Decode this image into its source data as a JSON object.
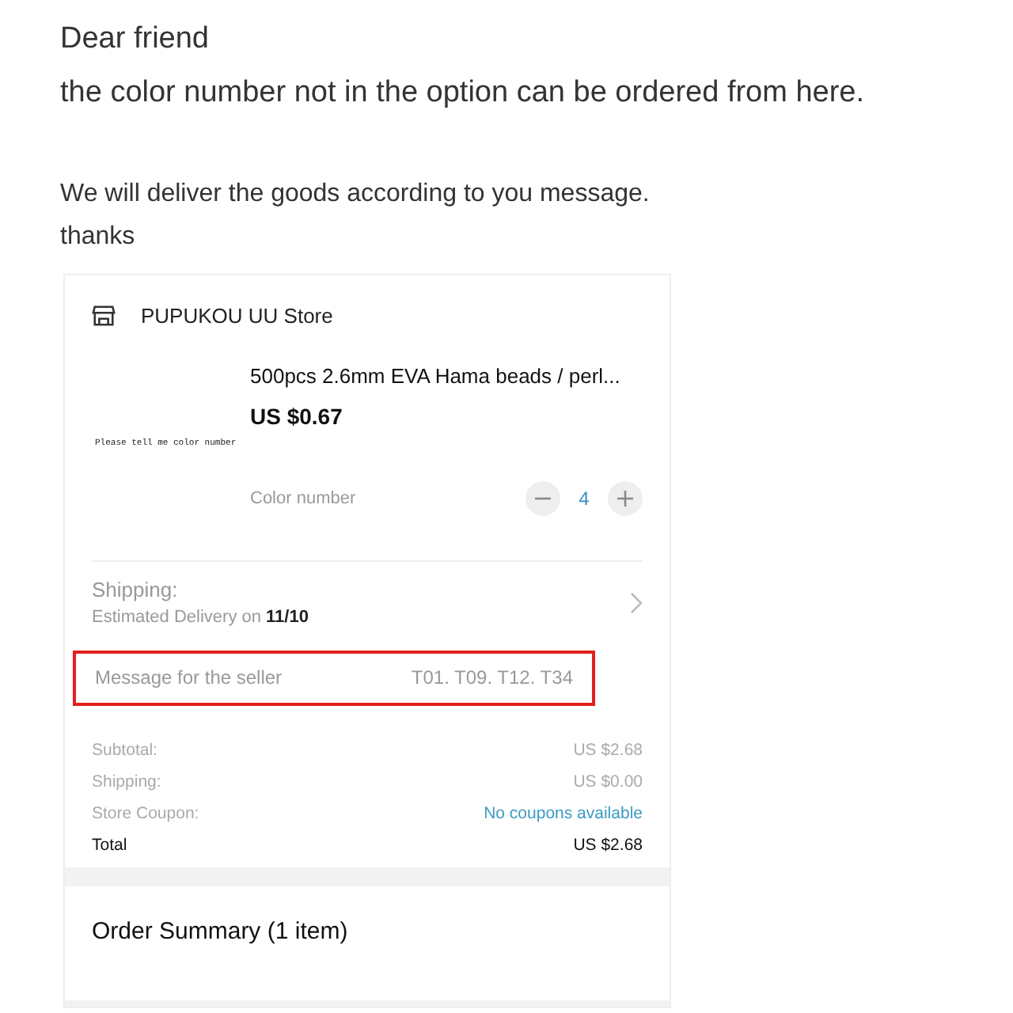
{
  "intro": {
    "greeting": "Dear friend",
    "line": "the color number not in the option can be ordered from here.",
    "note": "We will deliver the goods according to you message.",
    "closing": "thanks"
  },
  "store": {
    "name": "PUPUKOU UU Store"
  },
  "product": {
    "image_caption": "Please tell me color number",
    "title": "500pcs 2.6mm EVA Hama beads / perl...",
    "price": "US $0.67",
    "option_label": "Color number",
    "quantity": "4"
  },
  "shipping": {
    "label": "Shipping:",
    "delivery": "Estimated Delivery on **11/10**"
  },
  "message": {
    "label": "Message for the seller",
    "value": "T01. T09. T12. T34",
    "highlighted": true
  },
  "totals": [
    {
      "label": "Subtotal:",
      "value": "US $2.68",
      "kind": "plain"
    },
    {
      "label": "Shipping:",
      "value": "US $0.00",
      "kind": "plain"
    },
    {
      "label": "Store Coupon:",
      "value": "No coupons available",
      "kind": "link"
    },
    {
      "label": "Total",
      "value": "US $2.68",
      "kind": "total"
    }
  ],
  "summary": {
    "title": "Order Summary (1 item)"
  }
}
